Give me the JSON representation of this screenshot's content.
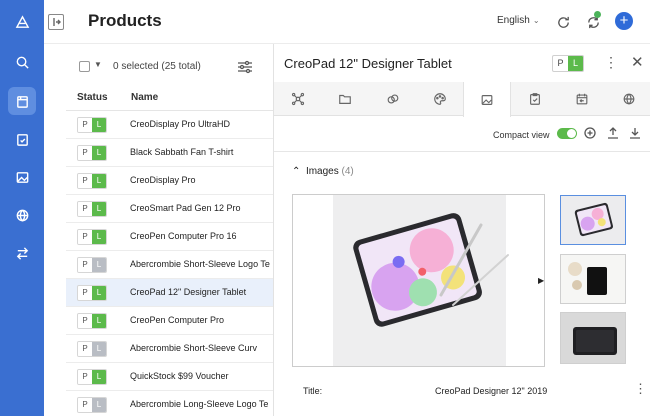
{
  "rail": {
    "items": [
      {
        "icon": "logo-icon"
      },
      {
        "icon": "search-icon"
      },
      {
        "icon": "products-icon",
        "active": true
      },
      {
        "icon": "clipboard-icon"
      },
      {
        "icon": "image-icon"
      },
      {
        "icon": "globe-icon"
      },
      {
        "icon": "transfer-icon"
      }
    ]
  },
  "header": {
    "title": "Products",
    "language": "English"
  },
  "list": {
    "selection": "0 selected (25 total)",
    "columns": {
      "status": "Status",
      "name": "Name"
    },
    "rows": [
      {
        "name": "CreoDisplay Pro UltraHD",
        "l_color": "#5cba4b"
      },
      {
        "name": "Black Sabbath Fan T-shirt",
        "l_color": "#5cba4b"
      },
      {
        "name": "CreoDisplay Pro",
        "l_color": "#5cba4b"
      },
      {
        "name": "CreoSmart Pad Gen 12 Pro",
        "l_color": "#5cba4b"
      },
      {
        "name": "CreoPen Computer Pro 16",
        "l_color": "#5cba4b"
      },
      {
        "name": "Abercrombie Short-Sleeve Logo Te",
        "l_color": "#b9bdc4"
      },
      {
        "name": "CreoPad 12\" Designer Tablet",
        "l_color": "#5cba4b",
        "selected": true
      },
      {
        "name": "CreoPen Computer Pro",
        "l_color": "#5cba4b"
      },
      {
        "name": "Abercrombie Short-Sleeve Curv",
        "l_color": "#b9bdc4"
      },
      {
        "name": "QuickStock $99 Voucher",
        "l_color": "#5cba4b"
      },
      {
        "name": "Abercrombie Long-Sleeve Logo Te",
        "l_color": "#b9bdc4"
      }
    ],
    "p_label": "P",
    "l_label": "L"
  },
  "panel": {
    "title": "CreoPad 12\" Designer Tablet",
    "p_label": "P",
    "l_label": "L",
    "tabs": [
      "relations-icon",
      "folder-icon",
      "link-icon",
      "palette-icon",
      "image-icon",
      "clipboard-check-icon",
      "calendar-icon",
      "globe-icon"
    ],
    "active_tab": 4,
    "compact_view_label": "Compact view",
    "images_label": "Images",
    "images_count": "(4)",
    "title_field_label": "Title:",
    "title_field_value": "CreoPad Designer 12\" 2019"
  },
  "colors": {
    "rail": "#3a6fd1",
    "accent": "#2f6bd8",
    "green": "#5cba4b",
    "grey": "#b9bdc4"
  }
}
